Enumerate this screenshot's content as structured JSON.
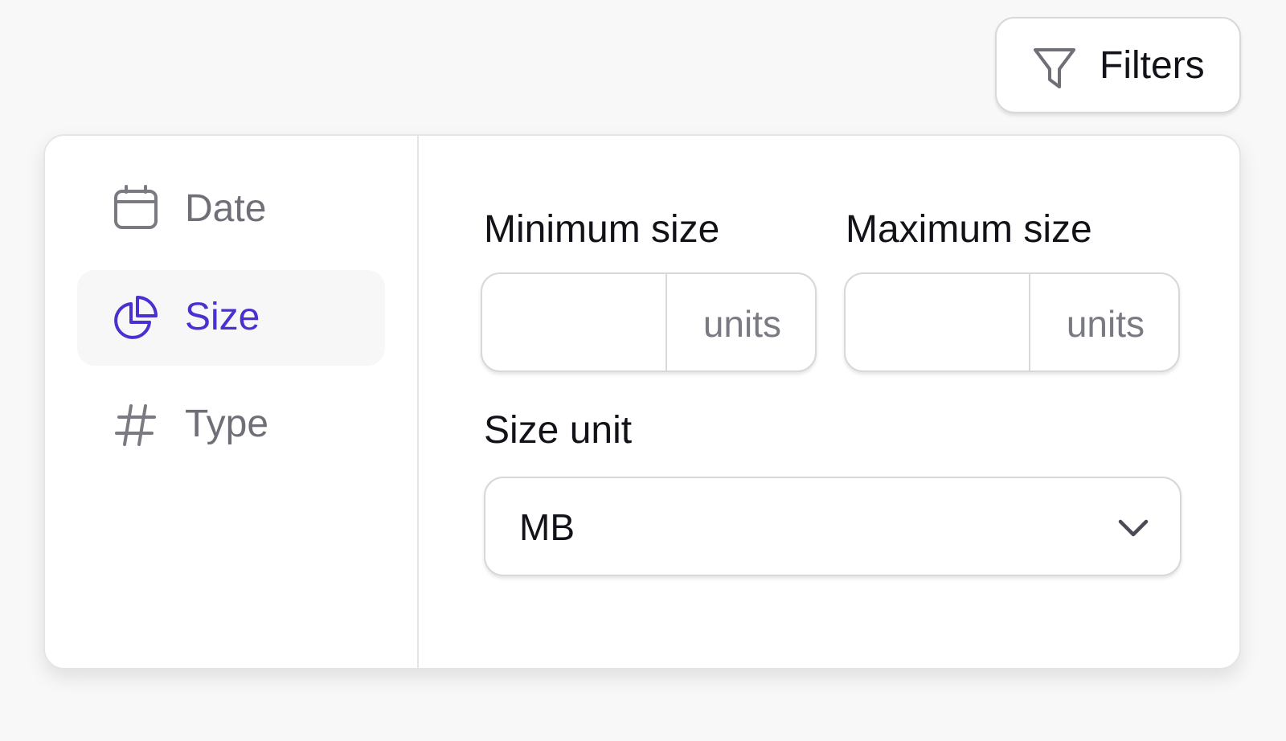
{
  "toolbar": {
    "filters_label": "Filters",
    "filters_icon": "filter-icon"
  },
  "sidebar": {
    "items": [
      {
        "label": "Date",
        "icon": "calendar-icon",
        "active": false
      },
      {
        "label": "Size",
        "icon": "pie-chart-icon",
        "active": true
      },
      {
        "label": "Type",
        "icon": "hash-icon",
        "active": false
      }
    ]
  },
  "size_filter": {
    "min_label": "Minimum size",
    "min_value": "",
    "min_suffix": "units",
    "max_label": "Maximum size",
    "max_value": "",
    "max_suffix": "units",
    "unit_label": "Size unit",
    "unit_selected": "MB"
  },
  "colors": {
    "accent": "#4b2fd0",
    "muted_text": "#6f6f78",
    "border": "#d8d8dc"
  }
}
